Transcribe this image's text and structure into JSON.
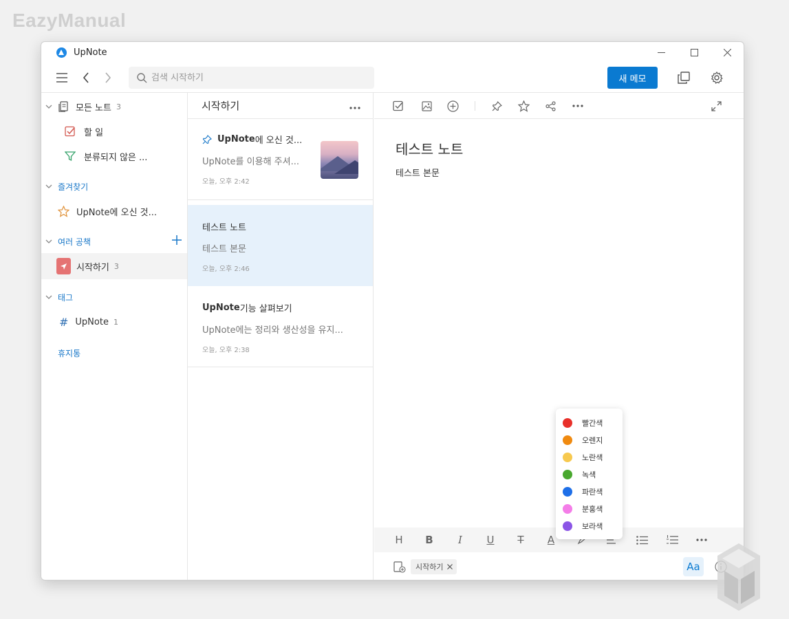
{
  "watermark": "EazyManual",
  "window": {
    "title": "UpNote"
  },
  "toolbar": {
    "search_placeholder": "검색 시작하기",
    "new_memo_label": "새 메모"
  },
  "sidebar": {
    "all_notes": {
      "label": "모든 노트",
      "count": "3"
    },
    "todo": {
      "label": "할 일"
    },
    "uncategorized": {
      "label": "분류되지 않은 ..."
    },
    "favorites_header": "즐겨찾기",
    "favorite_item": "UpNote에 오신 것...",
    "notebooks_header": "여러 공책",
    "notebook": {
      "label": "시작하기",
      "count": "3"
    },
    "tags_header": "태그",
    "tag": {
      "label": "UpNote",
      "count": "1"
    },
    "trash": "휴지통"
  },
  "note_list": {
    "title": "시작하기",
    "notes": [
      {
        "title_bold": "UpNote",
        "title_rest": "에 오신 것...",
        "body": "UpNote를 이용해 주셔...",
        "time": "오늘, 오후 2:42"
      },
      {
        "title": "테스트 노트",
        "body": "테스트 본문",
        "time": "오늘, 오후 2:46"
      },
      {
        "title_bold": "UpNote",
        "title_rest": " 기능 살펴보기",
        "body": "UpNote에는 정리와 생산성을 유지...",
        "time": "오늘, 오후 2:38"
      }
    ]
  },
  "editor": {
    "title": "테스트 노트",
    "body": "테스트 본문",
    "format": {
      "heading": "H",
      "bold": "B",
      "italic": "I",
      "underline": "U",
      "strike": "T",
      "color": "A"
    },
    "tag_chip": "시작하기",
    "aa": "Aa"
  },
  "colors": [
    {
      "label": "빨간색",
      "hex": "#e8302a"
    },
    {
      "label": "오렌지",
      "hex": "#f08a10"
    },
    {
      "label": "노란색",
      "hex": "#f7c94f"
    },
    {
      "label": "녹색",
      "hex": "#49a82e"
    },
    {
      "label": "파란색",
      "hex": "#1e6fe8"
    },
    {
      "label": "분홍색",
      "hex": "#f47de8"
    },
    {
      "label": "보라색",
      "hex": "#8b55e6"
    }
  ]
}
